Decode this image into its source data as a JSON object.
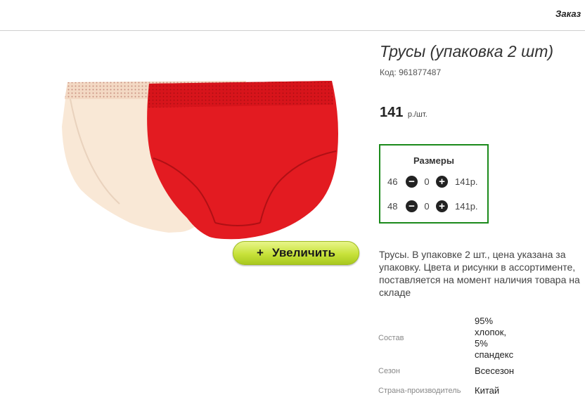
{
  "header": {
    "orders_link": "Заказ"
  },
  "product": {
    "title": "Трусы (упаковка 2 шт)",
    "code": "Код: 961877487",
    "price": "141",
    "price_unit": "р./шт."
  },
  "zoom_button": {
    "label": "Увеличить",
    "icon": "plus-icon"
  },
  "sizes": {
    "title": "Размеры",
    "items": [
      {
        "size": "46",
        "qty": "0",
        "price": "141р."
      },
      {
        "size": "48",
        "qty": "0",
        "price": "141р."
      }
    ]
  },
  "description": "Трусы. В упаковке 2 шт., цена указана за упаковку. Цвета и рисунки в ассортименте, поставляется на момент наличия товара на складе",
  "attributes": [
    {
      "label": "Состав",
      "value_lines": [
        "95%",
        "хлопок,",
        "5%",
        "спандекс"
      ]
    },
    {
      "label": "Сезон",
      "value_lines": [
        "Всесезон"
      ]
    },
    {
      "label": "Страна-производитель",
      "value_lines": [
        "Китай"
      ]
    }
  ],
  "colors": {
    "accent_border": "#1b8a1b",
    "button_green": "#c7e23a",
    "panty_red": "#e0181e",
    "panty_beige": "#f8e6d3"
  }
}
